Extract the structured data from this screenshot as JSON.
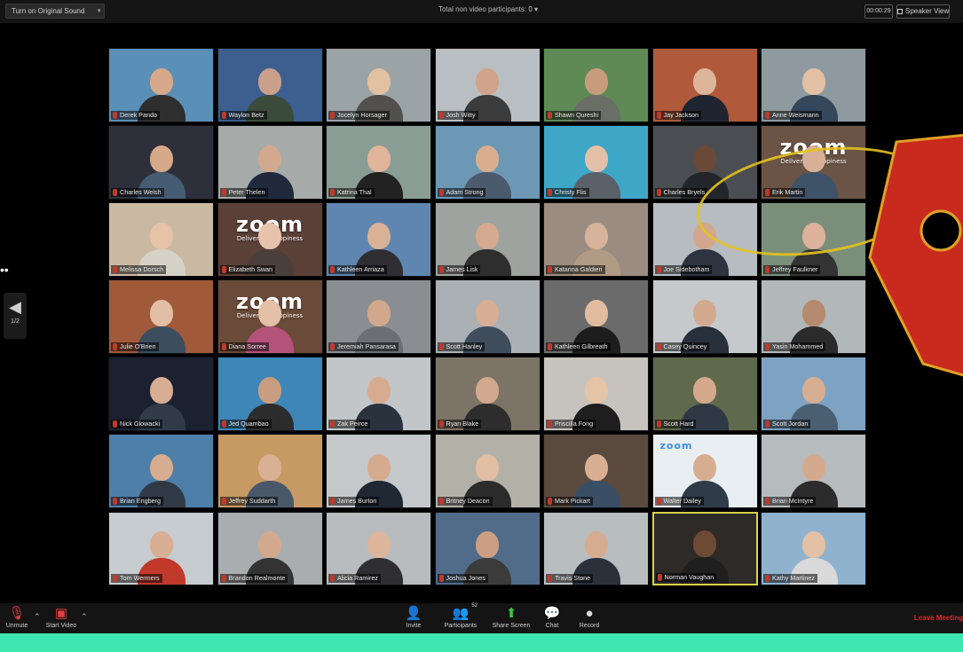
{
  "topbar": {
    "sound_button": "Turn on Original Sound",
    "title": "Total non video participants: 0",
    "timer": "00:00:29",
    "speaker_view": "Speaker View"
  },
  "paging": {
    "prev_arrow": "◀",
    "page": "1/2"
  },
  "participants": [
    {
      "name": "Derek Pando",
      "bg": "#5a8fb8",
      "skin": "#d7a98a",
      "shirt": "#2e2e2e"
    },
    {
      "name": "Waylon Betz",
      "bg": "#3d5f8f",
      "skin": "#caa08a",
      "shirt": "#3b4b3b"
    },
    {
      "name": "Jocelyn Horsager",
      "bg": "#9aa3a6",
      "skin": "#e2c0a2",
      "shirt": "#51504c"
    },
    {
      "name": "Josh Witty",
      "bg": "#b9bec2",
      "skin": "#cfa48b",
      "shirt": "#3b3b3b"
    },
    {
      "name": "Shawn Qureshi",
      "bg": "#5f8a56",
      "skin": "#c69c7c",
      "shirt": "#6a6f66"
    },
    {
      "name": "Jay Jackson",
      "bg": "#b05a3b",
      "skin": "#dcb49a",
      "shirt": "#1f2530"
    },
    {
      "name": "Anne Weismann",
      "bg": "#8f9aa0",
      "skin": "#e3c1a4",
      "shirt": "#34475b"
    },
    {
      "name": "Charles Welsh",
      "bg": "#2d2f3a",
      "skin": "#d6a98b",
      "shirt": "#465c72"
    },
    {
      "name": "Peter Thelen",
      "bg": "#a6aaa9",
      "skin": "#d2a98f",
      "shirt": "#202a3c"
    },
    {
      "name": "Katrina Thal",
      "bg": "#8a9d95",
      "skin": "#e0b59c",
      "shirt": "#222"
    },
    {
      "name": "Adam Strong",
      "bg": "#6c98b6",
      "skin": "#d9ad90",
      "shirt": "#4b5a6d"
    },
    {
      "name": "Christy Flis",
      "bg": "#3ea7c8",
      "skin": "#e4c0a8",
      "shirt": "#5b6169"
    },
    {
      "name": "Charles Bryels",
      "bg": "#4a4e52",
      "skin": "#6a4938",
      "shirt": "#22262b"
    },
    {
      "name": "Erik Martin",
      "bg": "#6b5445",
      "skin": "#d7b095",
      "shirt": "#3f5368",
      "logo": "zoom",
      "logo_sub": "Delivering Happiness"
    },
    {
      "name": "Melissa Dorsch",
      "bg": "#c9b9a3",
      "skin": "#e6c2a6",
      "shirt": "#d7d2c8"
    },
    {
      "name": "Elizabeth Swan",
      "bg": "#5a4036",
      "skin": "#e7c3ab",
      "shirt": "#4a3f3a",
      "logo": "zoom",
      "logo_sub": "Delivering Happiness"
    },
    {
      "name": "Kathleen Arriaza",
      "bg": "#5f86b0",
      "skin": "#d9b197",
      "shirt": "#2f2f33"
    },
    {
      "name": "James Lisk",
      "bg": "#9fa3a0",
      "skin": "#d4aa90",
      "shirt": "#2e2e2e"
    },
    {
      "name": "Katarina Galdieri",
      "bg": "#9a8c80",
      "skin": "#d6b39a",
      "shirt": "#b29b84"
    },
    {
      "name": "Joe Sidebotham",
      "bg": "#b6bcbf",
      "skin": "#d1a88d",
      "shirt": "#2d3440"
    },
    {
      "name": "Jeffrey Faulkner",
      "bg": "#7a8e7a",
      "skin": "#dcb29a",
      "shirt": "#333"
    },
    {
      "name": "Julie O'Brien",
      "bg": "#a05a3a",
      "skin": "#e2bea5",
      "shirt": "#3c4d5e"
    },
    {
      "name": "Diana Sorree",
      "bg": "#6a4a38",
      "skin": "#e4c0a7",
      "shirt": "#b5527a",
      "logo": "zoom",
      "logo_sub": "Delivering Happiness"
    },
    {
      "name": "Jeremiah Pansarasa",
      "bg": "#8a8e92",
      "skin": "#d1a88c",
      "shirt": "#6b6f73"
    },
    {
      "name": "Scott Hanley",
      "bg": "#aab0b3",
      "skin": "#d8ae94",
      "shirt": "#3f4d5c"
    },
    {
      "name": "Kathleen Gilbreath",
      "bg": "#6b6b6b",
      "skin": "#e1bc9f",
      "shirt": "#1d1d1d"
    },
    {
      "name": "Casey Quincey",
      "bg": "#c5c9cb",
      "skin": "#d3a98f",
      "shirt": "#28303c"
    },
    {
      "name": "Yasin Mohammed",
      "bg": "#b2b7ba",
      "skin": "#b58a6e",
      "shirt": "#2b2b2b"
    },
    {
      "name": "Nick Glowacki",
      "bg": "#1b2130",
      "skin": "#d7ad93",
      "shirt": "#303a48"
    },
    {
      "name": "Jed Quambao",
      "bg": "#3f86b8",
      "skin": "#c99d80",
      "shirt": "#2c2c2c"
    },
    {
      "name": "Zak Peirce",
      "bg": "#c2c6c8",
      "skin": "#d6ab90",
      "shirt": "#2a323e"
    },
    {
      "name": "Ryan Blake",
      "bg": "#7c7467",
      "skin": "#d2a98e",
      "shirt": "#2d2d2d"
    },
    {
      "name": "Priscilla Fong",
      "bg": "#c6c3bf",
      "skin": "#e4c3a6",
      "shirt": "#1e1e1e"
    },
    {
      "name": "Scott Hard",
      "bg": "#5f6a4d",
      "skin": "#d4a98c",
      "shirt": "#2e3945"
    },
    {
      "name": "Scott Jordan",
      "bg": "#7ea2c2",
      "skin": "#d8ae93",
      "shirt": "#4b5f72"
    },
    {
      "name": "Brian Engberg",
      "bg": "#4e7fa8",
      "skin": "#d6ac91",
      "shirt": "#2f3a46"
    },
    {
      "name": "Jeffrey Suddarth",
      "bg": "#c79a63",
      "skin": "#dab095",
      "shirt": "#495869"
    },
    {
      "name": "James Burton",
      "bg": "#c4c8ca",
      "skin": "#d5aa8e",
      "shirt": "#1f2733"
    },
    {
      "name": "Britney Deacon",
      "bg": "#b3b0a8",
      "skin": "#e2bfa4",
      "shirt": "#2b2b2b"
    },
    {
      "name": "Mark Pickart",
      "bg": "#5a4a3e",
      "skin": "#d8af93",
      "shirt": "#3a4f66"
    },
    {
      "name": "Walter Dailey",
      "bg": "#e9eef2",
      "skin": "#d7ad92",
      "shirt": "#2f3b48",
      "logo": "zoom",
      "logo_small": true
    },
    {
      "name": "Brian McIntyre",
      "bg": "#b6bbbd",
      "skin": "#d4aa8e",
      "shirt": "#2c2c2c"
    },
    {
      "name": "Tom Wermers",
      "bg": "#c7ccd0",
      "skin": "#d8ae94",
      "shirt": "#c0392b"
    },
    {
      "name": "Brandon Realmonte",
      "bg": "#a9adaf",
      "skin": "#d3a98d",
      "shirt": "#333"
    },
    {
      "name": "Alicia Ramirez",
      "bg": "#b9bcbf",
      "skin": "#dcb59b",
      "shirt": "#2f2f33"
    },
    {
      "name": "Joshua Jones",
      "bg": "#516b8a",
      "skin": "#cc9f84",
      "shirt": "#3b3b3b"
    },
    {
      "name": "Travis Stone",
      "bg": "#b8bdc0",
      "skin": "#d6ac91",
      "shirt": "#2a313b"
    },
    {
      "name": "Norman Vaughan",
      "bg": "#2e2a28",
      "skin": "#6d4a36",
      "shirt": "#1f1f1f",
      "active": true
    },
    {
      "name": "Kathy Martinez",
      "bg": "#8fb3cf",
      "skin": "#e3c0a6",
      "shirt": "#d9d9d9"
    }
  ],
  "toolbar": {
    "unmute": "Unmute",
    "start_video": "Start Video",
    "invite": "Invite",
    "participants": "Participants",
    "participants_count": "52",
    "share_screen": "Share Screen",
    "chat": "Chat",
    "record": "Record",
    "leave": "Leave Meeting"
  },
  "colors": {
    "active_border": "#d8d44a",
    "leave": "#e02424",
    "bottom_strip": "#3fe6b0",
    "tag": "#c92a1e",
    "ring": "#e5c21c"
  }
}
